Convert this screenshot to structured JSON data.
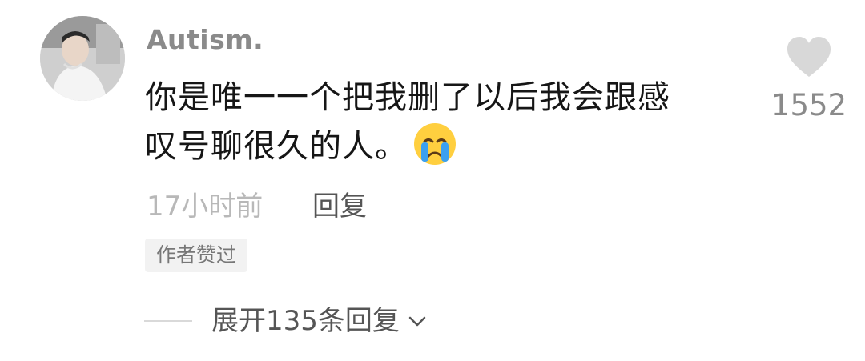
{
  "comment": {
    "username": "Autism.",
    "text_line1": "你是唯一一个把我删了以后我会跟感",
    "text_line2": "叹号聊很久的人。",
    "emoji": "crying-face-emoji",
    "timestamp": "17小时前",
    "reply_label": "回复",
    "author_badge": "作者赞过",
    "expand_replies_label": "展开135条回复",
    "like_count": "1552"
  },
  "icons": {
    "avatar": "avatar-photo",
    "like": "heart-icon",
    "expand": "chevron-down-icon"
  },
  "colors": {
    "username": "#8a8a8a",
    "text": "#161616",
    "meta": "#b8b8b8",
    "action": "#555555",
    "badge_bg": "#f2f2f2",
    "heart": "#d8d8d8"
  }
}
